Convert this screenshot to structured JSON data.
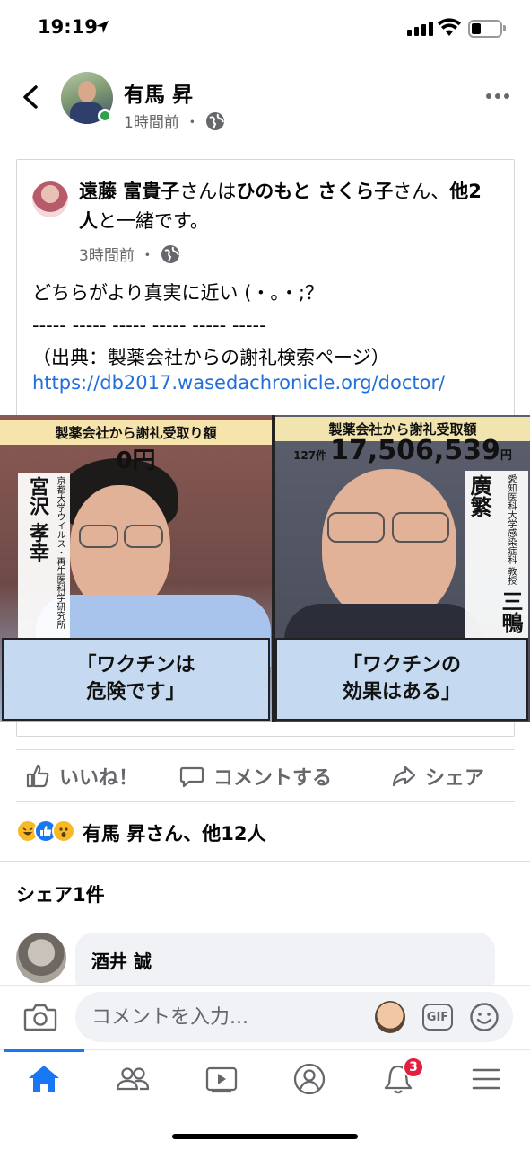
{
  "status_bar": {
    "time": "19:19"
  },
  "post": {
    "author": "有馬 昇",
    "time": "1時間前",
    "privacy_separator": "・"
  },
  "shared": {
    "tagger": "遠藤 富貴子",
    "tag_mid": "さんは",
    "tagged": "ひのもと さくら子",
    "tag_mid2": "さん、",
    "others": "他2人",
    "tag_end": "と一緒です。",
    "time": "3時間前",
    "privacy_separator": "・",
    "body": "どちらがより真実に近い (・。・;？\n----- ----- ----- ----- ----- -----\n（出典：製薬会社からの謝礼検索ページ）",
    "link": "https://db2017.wasedachronicle.org/doctor/"
  },
  "media": {
    "left": {
      "headline": "製薬会社から謝礼受取り額",
      "amount": "0円",
      "affiliation": "京都大学ウイルス・再生医科学研究所",
      "name": "宮沢 孝幸",
      "caption_line1": "「ワクチンは",
      "caption_line2": "危険です」"
    },
    "right": {
      "headline": "製薬会社から謝礼受取額",
      "count": "127件",
      "amount": "17,506,539",
      "unit": "円",
      "affiliation": "愛知医科大学感染症科 教授",
      "name": "三鴨 廣繁",
      "caption_line1": "「ワクチンの",
      "caption_line2": "効果はある」"
    }
  },
  "actions": {
    "like": "いいね！",
    "comment": "コメントする",
    "share": "シェア"
  },
  "reactions": {
    "summary": "有馬 昇さん、他12人"
  },
  "shares": {
    "title": "シェア1件",
    "items": [
      {
        "name": "酒井 誠"
      }
    ]
  },
  "composer": {
    "placeholder": "コメントを入力...",
    "gif_label": "GIF"
  },
  "tabbar": {
    "notification_count": "3",
    "accent": "#1877f2"
  }
}
